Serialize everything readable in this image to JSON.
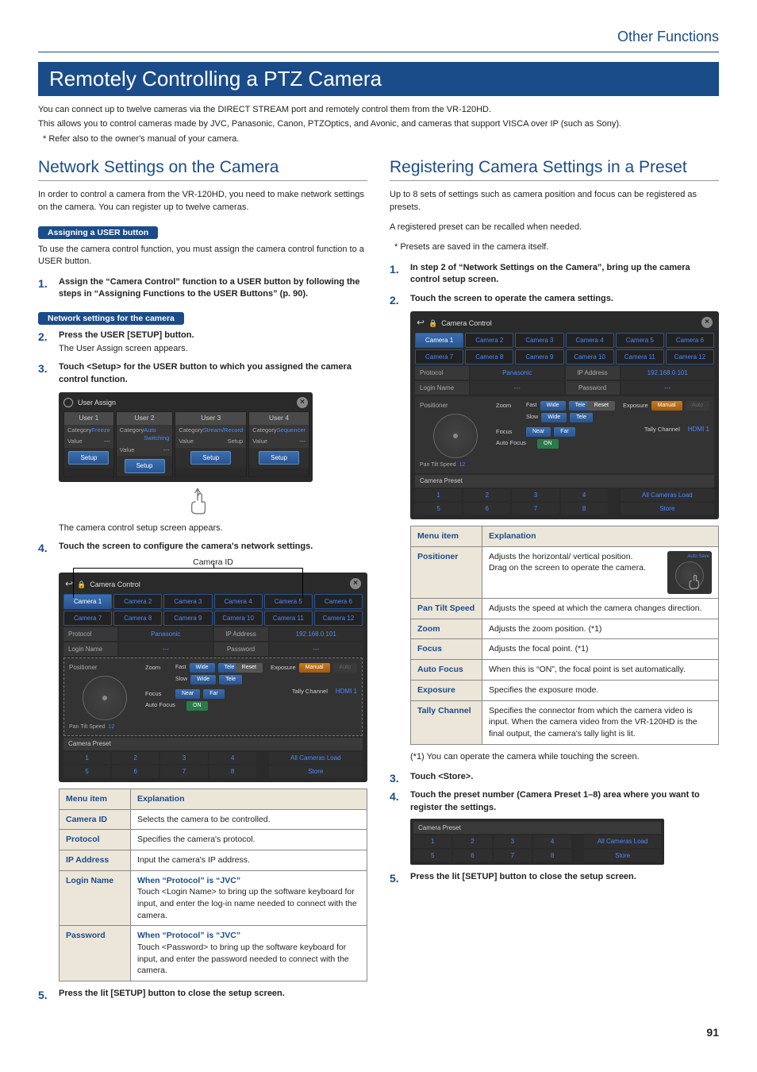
{
  "breadcrumb": "Other Functions",
  "h1": "Remotely Controlling a PTZ Camera",
  "intro": {
    "p1": "You can connect up to twelve cameras via the DIRECT STREAM port and remotely control them from the VR-120HD.",
    "p2": "This allows you to control cameras made by JVC, Panasonic, Canon, PTZOptics, and Avonic, and cameras that support VISCA over IP (such as Sony).",
    "p3": "* Refer also to the owner's manual of your camera."
  },
  "left": {
    "h2": "Network Settings on the Camera",
    "intro": "In order to control a camera from the VR-120HD, you need to make network settings on the camera. You can register up to twelve cameras.",
    "pill1": "Assigning a USER button",
    "pill1_text": "To use the camera control function, you must assign the camera control function to a USER button.",
    "step1": "Assign the “Camera Control” function to a USER button by following the steps in “Assigning Functions to the USER Buttons” (p. 90).",
    "pill2": "Network settings for the camera",
    "step2": "Press the USER [SETUP] button.",
    "step2_sub": "The User Assign screen appears.",
    "step3": "Touch <Setup> for the USER button to which you assigned the camera control function.",
    "step3_after": "The camera control setup screen appears.",
    "step4": "Touch the screen to configure the camera's network settings.",
    "callout_cam_id": "Camera ID",
    "step5": "Press the lit [SETUP] button to close the setup screen.",
    "ua": {
      "title": "User Assign",
      "users": [
        "User 1",
        "User 2",
        "User 3",
        "User 4"
      ],
      "cat_label": "Category",
      "val_label": "Value",
      "cats": [
        "Freeze",
        "Auto Switching",
        "Stream/Record",
        "Sequencer"
      ],
      "val3": "Setup",
      "setup": "Setup"
    },
    "table": {
      "h1": "Menu item",
      "h2": "Explanation",
      "r1a": "Camera ID",
      "r1b": "Selects the camera to be controlled.",
      "r2a": "Protocol",
      "r2b": "Specifies the camera's protocol.",
      "r3a": "IP Address",
      "r3b": "Input the camera's IP address.",
      "r4a": "Login Name",
      "r4b_when": "When “Protocol” is “JVC”",
      "r4b": "Touch <Login Name> to bring up the software keyboard for input, and enter the log-in name needed to connect with the camera.",
      "r5a": "Password",
      "r5b_when": "When “Protocol” is “JVC”",
      "r5b": "Touch <Password> to bring up the software keyboard for input, and enter the password needed to connect with the camera."
    }
  },
  "right": {
    "h2": "Registering Camera Settings in a Preset",
    "intro1": "Up to 8 sets of settings such as camera position and focus can be registered as presets.",
    "intro2": "A registered preset can be recalled when needed.",
    "intro3": "* Presets are saved in the camera itself.",
    "step1": "In step 2 of “Network Settings on the Camera”, bring up the camera control setup screen.",
    "step2": "Touch the screen to operate the camera settings.",
    "step3": "Touch <Store>.",
    "step4": "Touch the preset number (Camera Preset 1–8) area where you want to register the settings.",
    "step5": "Press the lit [SETUP] button to close the setup screen.",
    "footnote": "(*1) You can operate the camera while touching the screen.",
    "table": {
      "h1": "Menu item",
      "h2": "Explanation",
      "r1a": "Positioner",
      "r1b": "Adjusts the horizontal/ vertical position.\nDrag on the screen to operate the camera.",
      "r2a": "Pan Tilt Speed",
      "r2b": "Adjusts the speed at which the camera changes direction.",
      "r3a": "Zoom",
      "r3b": "Adjusts the zoom position. (*1)",
      "r4a": "Focus",
      "r4b": "Adjusts the focal point. (*1)",
      "r5a": "Auto Focus",
      "r5b": "When this is “ON”, the focal point is set automatically.",
      "r6a": "Exposure",
      "r6b": "Specifies the exposure mode.",
      "r7a": "Tally Channel",
      "r7b": "Specifies the connector from which the camera video is input. When the camera video from the VR-120HD is the final output, the camera's tally light is lit."
    }
  },
  "cam": {
    "title": "Camera Control",
    "cams": [
      "Camera 1",
      "Camera 2",
      "Camera 3",
      "Camera 4",
      "Camera 5",
      "Camera 6",
      "Camera 7",
      "Camera 8",
      "Camera 9",
      "Camera 10",
      "Camera 11",
      "Camera 12"
    ],
    "protocol_lbl": "Protocol",
    "protocol_val": "Panasonic",
    "ip_lbl": "IP Address",
    "ip_val": "192.168.0.101",
    "login_lbl": "Login Name",
    "login_val": "---",
    "pass_lbl": "Password",
    "pass_val": "---",
    "positioner": "Positioner",
    "pan_tilt": "Pan Tilt Speed",
    "pan_tilt_val": "12",
    "zoom": "Zoom",
    "fast": "Fast",
    "slow": "Slow",
    "wide": "Wide",
    "tele": "Tele",
    "focus": "Focus",
    "near": "Near",
    "far": "Far",
    "auto_focus": "Auto Focus",
    "on": "ON",
    "reset": "Reset",
    "exposure": "Exposure",
    "manual": "Manual",
    "auto": "Auto",
    "tally": "Tally Channel",
    "hdmi1": "HDMI 1",
    "preset_hdr": "Camera Preset",
    "presets": [
      "1",
      "2",
      "3",
      "4",
      "5",
      "6",
      "7",
      "8"
    ],
    "all_load": "All Cameras Load",
    "store": "Store"
  },
  "page": "91"
}
